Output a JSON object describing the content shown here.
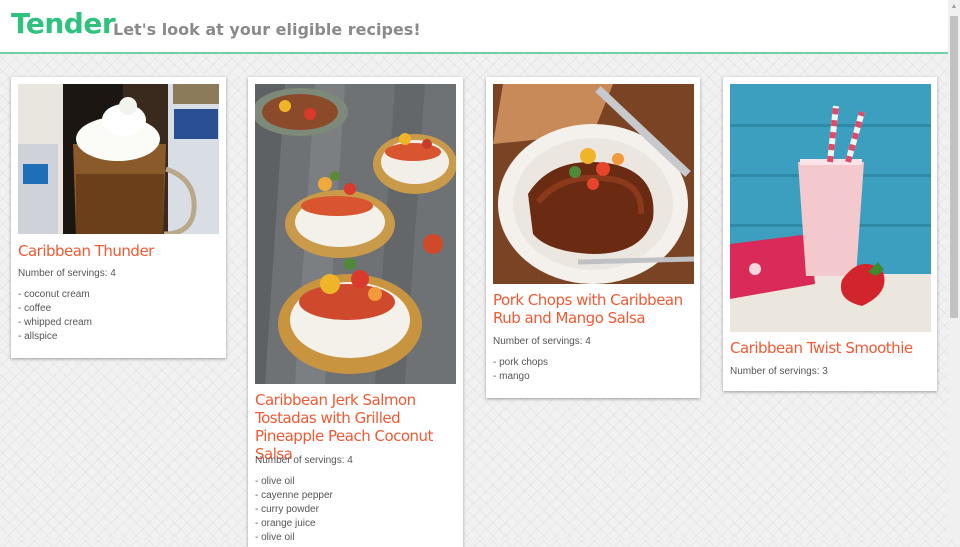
{
  "header": {
    "brand": "Tender",
    "tagline": "Let's look at your eligible recipes!"
  },
  "recipes": [
    {
      "title": "Caribbean Thunder",
      "servings_label": "Number of servings: ",
      "servings": "4",
      "ingredients": [
        "- coconut cream",
        "- coffee",
        "- whipped cream",
        "- allspice"
      ]
    },
    {
      "title": "Caribbean Jerk Salmon Tostadas with Grilled Pineapple Peach Coconut Salsa",
      "servings_label": "Number of servings: ",
      "servings": "4",
      "ingredients": [
        "- olive oil",
        "- cayenne pepper",
        "- curry powder",
        "- orange juice",
        "- olive oil"
      ]
    },
    {
      "title": "Pork Chops with Caribbean Rub and Mango Salsa",
      "servings_label": "Number of servings: ",
      "servings": "4",
      "ingredients": [
        "- pork chops",
        "- mango"
      ]
    },
    {
      "title": "Caribbean Twist Smoothie",
      "servings_label": "Number of servings: ",
      "servings": "3",
      "ingredients": []
    }
  ]
}
